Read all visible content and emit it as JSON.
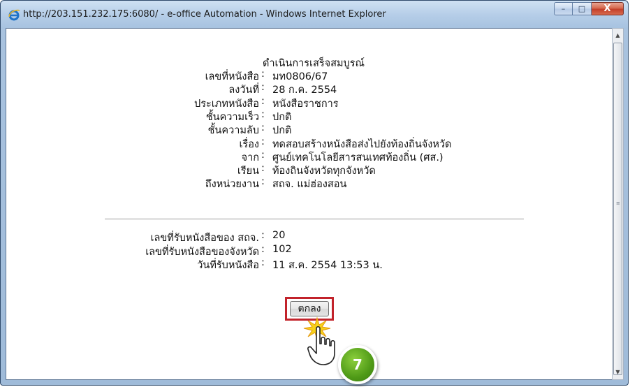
{
  "window": {
    "title": "http://203.151.232.175:6080/ - e-office Automation - Windows Internet Explorer",
    "controls": {
      "minimize": "–",
      "maximize": "□",
      "close": "X"
    }
  },
  "document": {
    "heading": "ดำเนินการเสร็จสมบูรณ์",
    "rows": [
      {
        "label": "เลขที่หนังสือ",
        "value": "มท0806/67"
      },
      {
        "label": "ลงวันที่",
        "value": "28 ก.ค. 2554"
      },
      {
        "label": "ประเภทหนังสือ",
        "value": "หนังสือราชการ"
      },
      {
        "label": "ชั้นความเร็ว",
        "value": "ปกติ"
      },
      {
        "label": "ชั้นความลับ",
        "value": "ปกติ"
      },
      {
        "label": "เรื่อง",
        "value": "ทดสอบสร้างหนังสือส่งไปยังท้องถิ่นจังหวัด"
      },
      {
        "label": "จาก",
        "value": "ศูนย์เทคโนโลยีสารสนเทศท้องถิ่น (ศส.)"
      },
      {
        "label": "เรียน",
        "value": "ท้องถินจังหวัดทุกจังหวัด"
      },
      {
        "label": "ถึงหน่วยงาน",
        "value": "สถจ. แม่ฮ่องสอน"
      }
    ],
    "receipt_rows": [
      {
        "label": "เลขที่รับหนังสือของ สถจ.",
        "value": "20"
      },
      {
        "label": "เลขที่รับหนังสือของจังหวัด",
        "value": "102"
      },
      {
        "label": "วันที่รับหนังสือ",
        "value": "11 ส.ค. 2554 13:53 น."
      }
    ],
    "colon": ":",
    "ok_button": "ตกลง"
  },
  "annotation": {
    "step_number": "7"
  },
  "colors": {
    "highlight": "#c2232b",
    "step_badge": "#4f9a17"
  }
}
